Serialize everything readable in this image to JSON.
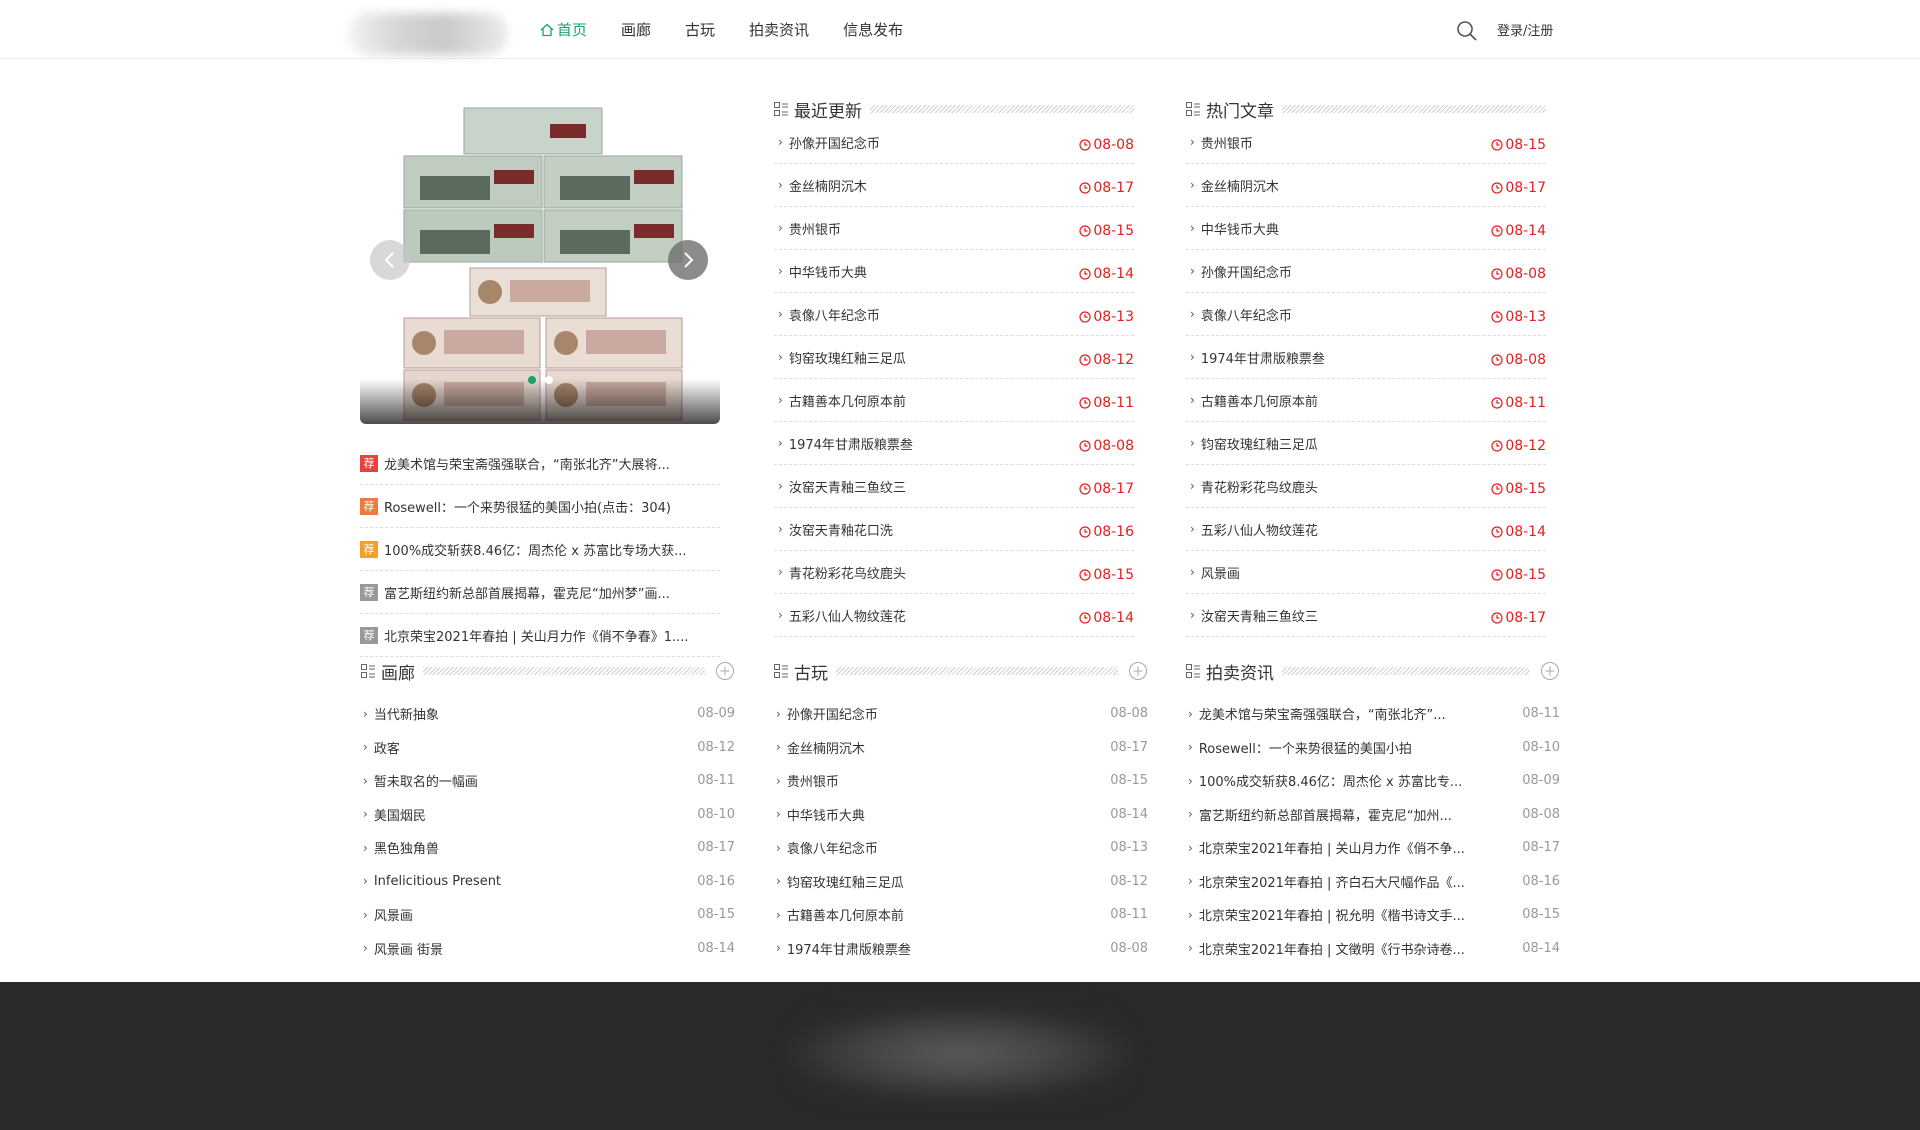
{
  "nav": {
    "items": [
      {
        "label": "首页",
        "active": true
      },
      {
        "label": "画廊",
        "active": false
      },
      {
        "label": "古玩",
        "active": false
      },
      {
        "label": "拍卖资讯",
        "active": false
      },
      {
        "label": "信息发布",
        "active": false
      }
    ],
    "login_label": "登录/注册"
  },
  "recommend": {
    "items": [
      {
        "tag": "荐",
        "color": "#e8433b",
        "text": "龙美术馆与荣宝斋强强联合，“南张北齐”大展将..."
      },
      {
        "tag": "荐",
        "color": "#f07a3b",
        "text": "Rosewell：一个来势很猛的美国小拍(点击：304)"
      },
      {
        "tag": "荐",
        "color": "#f0a030",
        "text": "100%成交斩获8.46亿：周杰伦 x 苏富比专场大获..."
      },
      {
        "tag": "荐",
        "color": "#999999",
        "text": "富艺斯纽约新总部首展揭幕，霍克尼“加州梦”画..."
      },
      {
        "tag": "荐",
        "color": "#999999",
        "text": "北京荣宝2021年春拍 | 关山月力作《俏不争春》1...."
      }
    ]
  },
  "recent": {
    "title": "最近更新",
    "items": [
      {
        "text": "孙像开国纪念币",
        "date": "08-08"
      },
      {
        "text": "金丝楠阴沉木",
        "date": "08-17"
      },
      {
        "text": "贵州银币",
        "date": "08-15"
      },
      {
        "text": "中华钱币大典",
        "date": "08-14"
      },
      {
        "text": "袁像八年纪念币",
        "date": "08-13"
      },
      {
        "text": "钧窑玫瑰红釉三足瓜",
        "date": "08-12"
      },
      {
        "text": "古籍善本几何原本前",
        "date": "08-11"
      },
      {
        "text": "1974年甘肃版粮票叁",
        "date": "08-08"
      },
      {
        "text": "汝窑天青釉三鱼纹三",
        "date": "08-17"
      },
      {
        "text": "汝窑天青釉花口洗",
        "date": "08-16"
      },
      {
        "text": "青花粉彩花鸟纹鹿头",
        "date": "08-15"
      },
      {
        "text": "五彩八仙人物纹莲花",
        "date": "08-14"
      }
    ]
  },
  "hot": {
    "title": "热门文章",
    "items": [
      {
        "text": "贵州银币",
        "date": "08-15"
      },
      {
        "text": "金丝楠阴沉木",
        "date": "08-17"
      },
      {
        "text": "中华钱币大典",
        "date": "08-14"
      },
      {
        "text": "孙像开国纪念币",
        "date": "08-08"
      },
      {
        "text": "袁像八年纪念币",
        "date": "08-13"
      },
      {
        "text": "1974年甘肃版粮票叁",
        "date": "08-08"
      },
      {
        "text": "古籍善本几何原本前",
        "date": "08-11"
      },
      {
        "text": "钧窑玫瑰红釉三足瓜",
        "date": "08-12"
      },
      {
        "text": "青花粉彩花鸟纹鹿头",
        "date": "08-15"
      },
      {
        "text": "五彩八仙人物纹莲花",
        "date": "08-14"
      },
      {
        "text": "风景画",
        "date": "08-15"
      },
      {
        "text": "汝窑天青釉三鱼纹三",
        "date": "08-17"
      }
    ]
  },
  "gallery": {
    "title": "画廊",
    "items": [
      {
        "text": "当代新抽象",
        "date": "08-09"
      },
      {
        "text": "政客",
        "date": "08-12"
      },
      {
        "text": "暂未取名的一幅画",
        "date": "08-11"
      },
      {
        "text": "美国烟民",
        "date": "08-10"
      },
      {
        "text": "黑色独角兽",
        "date": "08-17"
      },
      {
        "text": "Infelicitious Present",
        "date": "08-16"
      },
      {
        "text": "风景画",
        "date": "08-15"
      },
      {
        "text": "风景画 街景",
        "date": "08-14"
      }
    ]
  },
  "antique": {
    "title": "古玩",
    "items": [
      {
        "text": "孙像开国纪念币",
        "date": "08-08"
      },
      {
        "text": "金丝楠阴沉木",
        "date": "08-17"
      },
      {
        "text": "贵州银币",
        "date": "08-15"
      },
      {
        "text": "中华钱币大典",
        "date": "08-14"
      },
      {
        "text": "袁像八年纪念币",
        "date": "08-13"
      },
      {
        "text": "钧窑玫瑰红釉三足瓜",
        "date": "08-12"
      },
      {
        "text": "古籍善本几何原本前",
        "date": "08-11"
      },
      {
        "text": "1974年甘肃版粮票叁",
        "date": "08-08"
      }
    ]
  },
  "auction": {
    "title": "拍卖资讯",
    "items": [
      {
        "text": "龙美术馆与荣宝斋强强联合，“南张北齐”...",
        "date": "08-11"
      },
      {
        "text": "Rosewell：一个来势很猛的美国小拍",
        "date": "08-10"
      },
      {
        "text": "100%成交斩获8.46亿：周杰伦 x 苏富比专...",
        "date": "08-09"
      },
      {
        "text": "富艺斯纽约新总部首展揭幕，霍克尼“加州...",
        "date": "08-08"
      },
      {
        "text": "北京荣宝2021年春拍 | 关山月力作《俏不争...",
        "date": "08-17"
      },
      {
        "text": "北京荣宝2021年春拍 | 齐白石大尺幅作品《...",
        "date": "08-16"
      },
      {
        "text": "北京荣宝2021年春拍 | 祝允明《楷书诗文手...",
        "date": "08-15"
      },
      {
        "text": "北京荣宝2021年春拍 | 文徵明《行书杂诗卷...",
        "date": "08-14"
      }
    ]
  },
  "colors": {
    "accent": "#1f9e6a",
    "date_red": "#e02020",
    "footer": "#2a2a2c"
  },
  "icons": [
    "home-icon",
    "search-icon",
    "list-icon",
    "plus-circle-icon",
    "clock-icon",
    "chevron-left-icon",
    "chevron-right-icon"
  ]
}
